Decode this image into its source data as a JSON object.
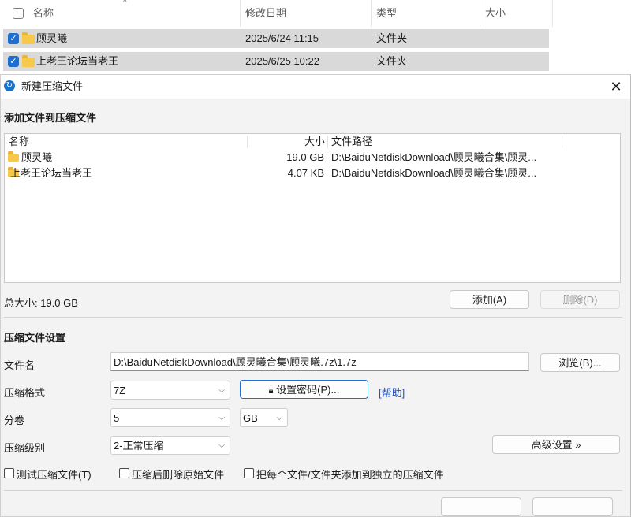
{
  "explorer": {
    "columns": [
      "名称",
      "修改日期",
      "类型",
      "大小"
    ],
    "rows": [
      {
        "name": "顾灵曦",
        "date": "2025/6/24 11:15",
        "type": "文件夹"
      },
      {
        "name": "上老王论坛当老王",
        "date": "2025/6/25 10:22",
        "type": "文件夹"
      }
    ]
  },
  "dialog": {
    "title": "新建压缩文件",
    "add_section_title": "添加文件到压缩文件",
    "list": {
      "headers": {
        "name": "名称",
        "size": "大小",
        "path": "文件路径"
      },
      "rows": [
        {
          "name": "顾灵曦",
          "size": "19.0 GB",
          "path": "D:\\BaiduNetdiskDownload\\顾灵曦合集\\顾灵..."
        },
        {
          "name": "上老王论坛当老王",
          "size": "4.07 KB",
          "path": "D:\\BaiduNetdiskDownload\\顾灵曦合集\\顾灵..."
        }
      ]
    },
    "total_size": "总大小: 19.0 GB",
    "add_button": "添加(A)",
    "delete_button": "删除(D)",
    "settings_title": "压缩文件设置",
    "filename_label": "文件名",
    "filename_value": "D:\\BaiduNetdiskDownload\\顾灵曦合集\\顾灵曦.7z\\1.7z",
    "browse_button": "浏览(B)...",
    "format_label": "压缩格式",
    "format_value": "7Z",
    "password_button": "设置密码(P)...",
    "help_link": "[帮助]",
    "volume_label": "分卷",
    "volume_value": "5",
    "volume_unit": "GB",
    "level_label": "压缩级别",
    "level_value": "2-正常压缩",
    "advanced_button": "高级设置 »",
    "options": {
      "test": "测试压缩文件(T)",
      "delete_after": "压缩后删除原始文件",
      "separate": "把每个文件/文件夹添加到独立的压缩文件"
    }
  }
}
